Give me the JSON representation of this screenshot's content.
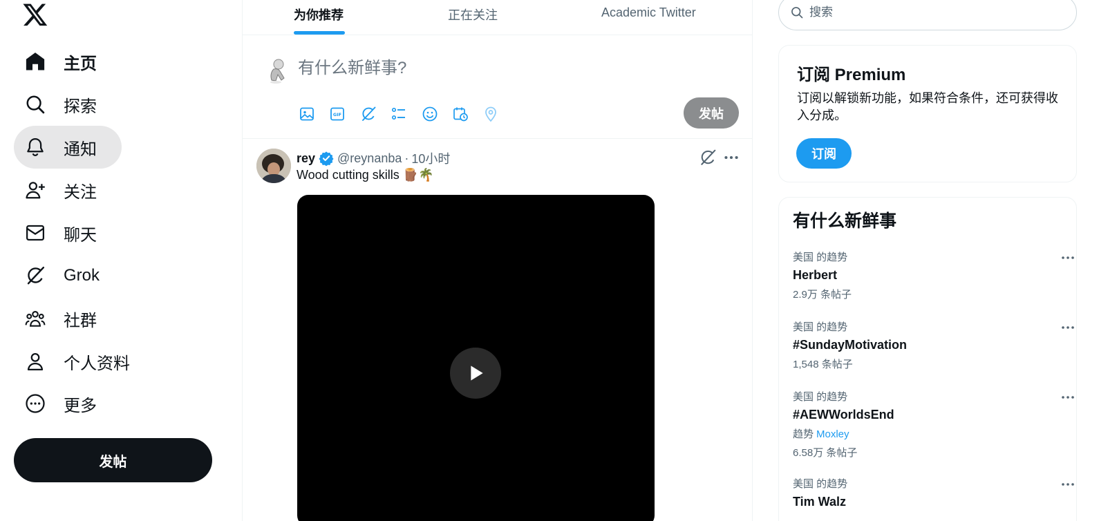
{
  "nav": {
    "items": [
      {
        "label": "主页",
        "icon": "home-icon"
      },
      {
        "label": "探索",
        "icon": "search-icon"
      },
      {
        "label": "通知",
        "icon": "bell-icon"
      },
      {
        "label": "关注",
        "icon": "add-person-icon"
      },
      {
        "label": "聊天",
        "icon": "mail-icon"
      },
      {
        "label": "Grok",
        "icon": "grok-icon"
      },
      {
        "label": "社群",
        "icon": "communities-icon"
      },
      {
        "label": "个人资料",
        "icon": "person-icon"
      },
      {
        "label": "更多",
        "icon": "more-circle-icon"
      }
    ],
    "post_label": "发帖"
  },
  "tabs": [
    "为你推荐",
    "正在关注",
    "Academic Twitter"
  ],
  "composer": {
    "placeholder": "有什么新鲜事?",
    "post_label": "发帖",
    "tools": [
      "image-icon",
      "gif-icon",
      "grok-icon",
      "poll-icon",
      "emoji-icon",
      "schedule-icon",
      "location-icon"
    ]
  },
  "tweet": {
    "name": "rey",
    "handle": "@reynanba",
    "separator": "·",
    "time": "10小时",
    "text": "Wood cutting skills 🪵🌴"
  },
  "search": {
    "placeholder": "搜索"
  },
  "premium": {
    "title": "订阅 Premium",
    "description": "订阅以解锁新功能，如果符合条件，还可获得收入分成。",
    "button_label": "订阅"
  },
  "trends": {
    "title": "有什么新鲜事",
    "items": [
      {
        "context": "美国 的趋势",
        "name": "Herbert",
        "count": "2.9万 条帖子"
      },
      {
        "context": "美国 的趋势",
        "name": "#SundayMotivation",
        "count": "1,548 条帖子"
      },
      {
        "context": "美国 的趋势",
        "name": "#AEWWorldsEnd",
        "sub_prefix": "趋势",
        "sub_link": "Moxley",
        "count": "6.58万 条帖子"
      },
      {
        "context": "美国 的趋势",
        "name": "Tim Walz",
        "count": ""
      }
    ]
  },
  "colors": {
    "accent": "#1d9bf0",
    "text": "#0f1419",
    "muted": "#536471",
    "active_bg": "#e7e7e8"
  }
}
